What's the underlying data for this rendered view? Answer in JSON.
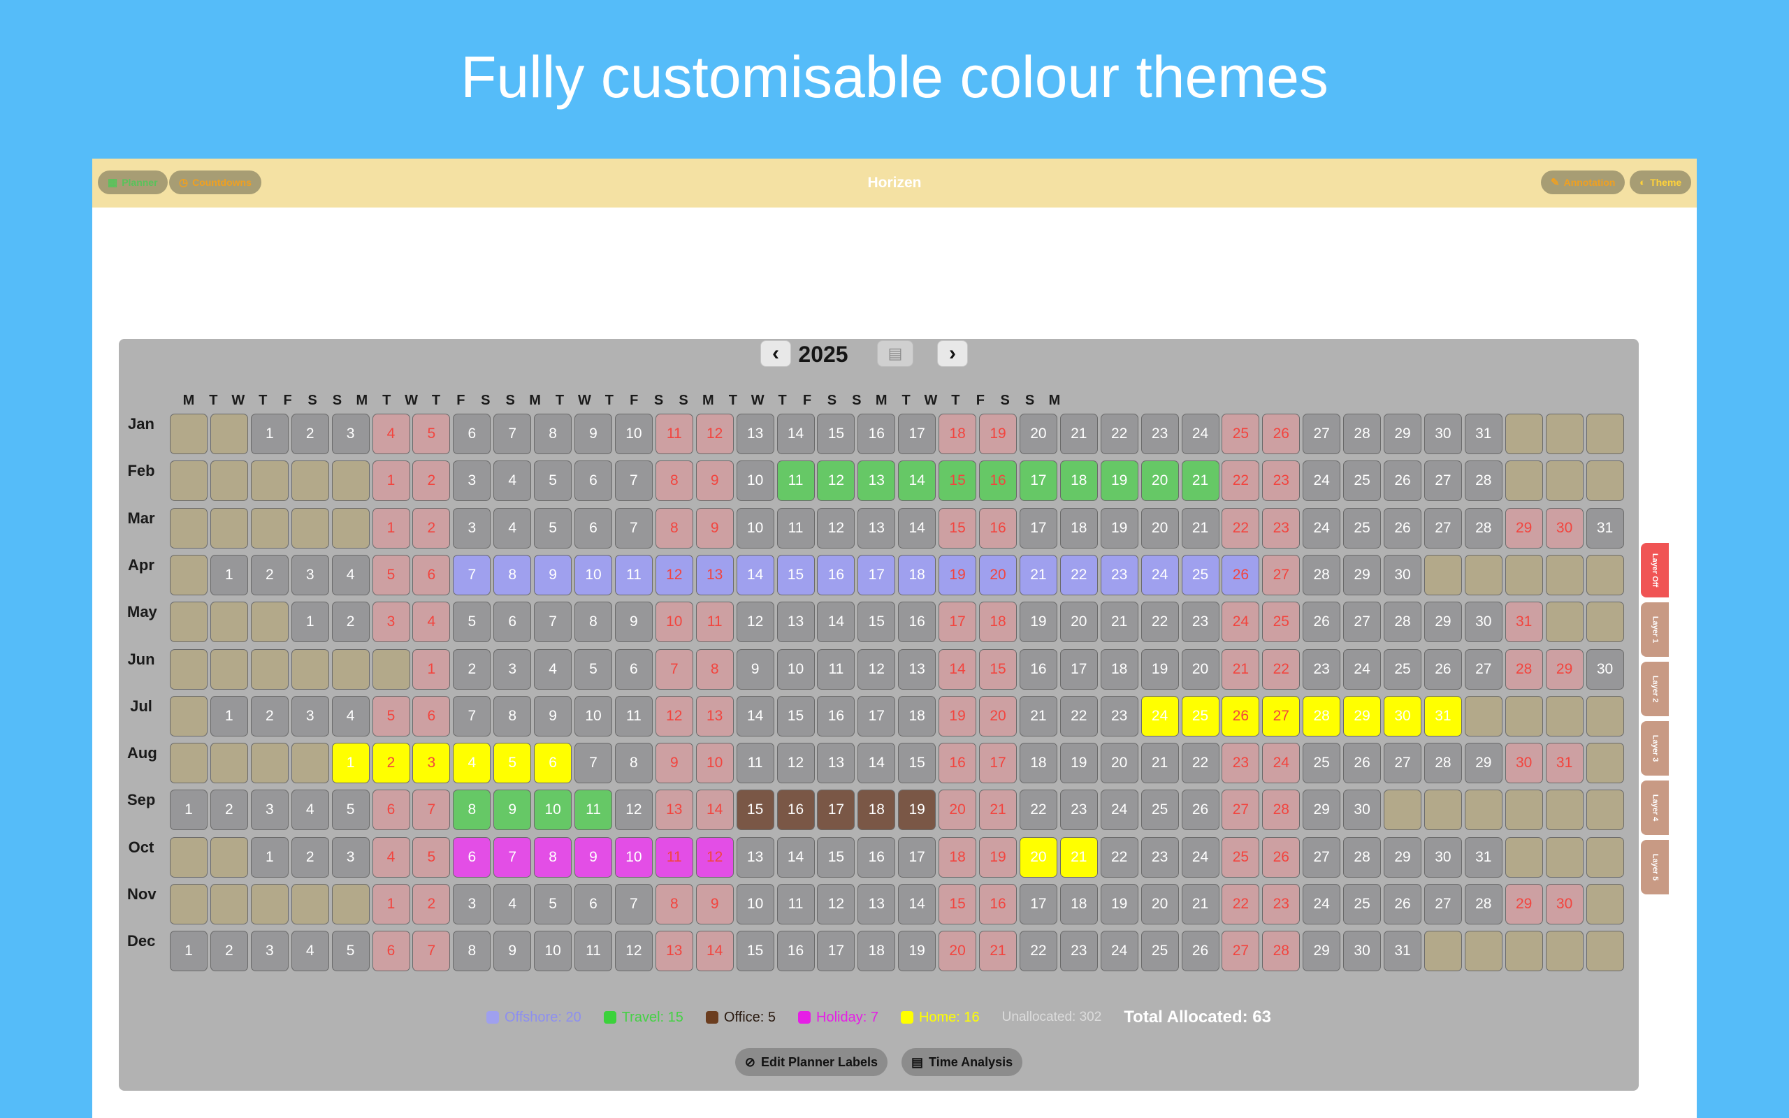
{
  "headline": "Fully customisable colour themes",
  "window": {
    "title": "Horizen",
    "left_buttons": [
      {
        "label": "Planner",
        "icon": "calendar-icon",
        "color": "#58c35b"
      },
      {
        "label": "Countdowns",
        "icon": "clock-icon",
        "color": "#f0a020"
      }
    ],
    "right_buttons": [
      {
        "label": "Annotation",
        "icon": "annotation-icon",
        "color": "#f0a020"
      },
      {
        "label": "Theme",
        "icon": "palette-icon",
        "color": "#ffd23a"
      }
    ]
  },
  "planner": {
    "year": "2025",
    "prev_icon": "chevron-left-icon",
    "next_icon": "chevron-right-icon",
    "doc_icon": "document-icon",
    "day_headers": [
      "M",
      "T",
      "W",
      "T",
      "F",
      "S",
      "S",
      "M",
      "T",
      "W",
      "T",
      "F",
      "S",
      "S",
      "M",
      "T",
      "W",
      "T",
      "F",
      "S",
      "S",
      "M",
      "T",
      "W",
      "T",
      "F",
      "S",
      "S",
      "M",
      "T",
      "W",
      "T",
      "F",
      "S",
      "S",
      "M"
    ],
    "months": [
      {
        "name": "Jan",
        "offset": 2,
        "days": 31,
        "alloc": {}
      },
      {
        "name": "Feb",
        "offset": 5,
        "days": 28,
        "alloc": {
          "11": "trv",
          "12": "trv",
          "13": "trv",
          "14": "trv",
          "15": "trv",
          "16": "trv",
          "17": "trv",
          "18": "trv",
          "19": "trv",
          "20": "trv",
          "21": "trv"
        }
      },
      {
        "name": "Mar",
        "offset": 5,
        "days": 31,
        "alloc": {}
      },
      {
        "name": "Apr",
        "offset": 1,
        "days": 30,
        "alloc": {
          "7": "off",
          "8": "off",
          "9": "off",
          "10": "off",
          "11": "off",
          "12": "off",
          "13": "off",
          "14": "off",
          "15": "off",
          "16": "off",
          "17": "off",
          "18": "off",
          "19": "off",
          "20": "off",
          "21": "off",
          "22": "off",
          "23": "off",
          "24": "off",
          "25": "off",
          "26": "off"
        }
      },
      {
        "name": "May",
        "offset": 3,
        "days": 31,
        "alloc": {}
      },
      {
        "name": "Jun",
        "offset": 6,
        "days": 30,
        "alloc": {}
      },
      {
        "name": "Jul",
        "offset": 1,
        "days": 31,
        "alloc": {
          "24": "home",
          "25": "home",
          "26": "home",
          "27": "home",
          "28": "home",
          "29": "home",
          "30": "home",
          "31": "home"
        }
      },
      {
        "name": "Aug",
        "offset": 4,
        "days": 31,
        "alloc": {
          "1": "home",
          "2": "home",
          "3": "home",
          "4": "home",
          "5": "home",
          "6": "home"
        }
      },
      {
        "name": "Sep",
        "offset": 0,
        "days": 30,
        "alloc": {
          "8": "trv",
          "9": "trv",
          "10": "trv",
          "11": "trv",
          "15": "ofc",
          "16": "ofc",
          "17": "ofc",
          "18": "ofc",
          "19": "ofc"
        }
      },
      {
        "name": "Oct",
        "offset": 2,
        "days": 31,
        "alloc": {
          "6": "hol",
          "7": "hol",
          "8": "hol",
          "9": "hol",
          "10": "hol",
          "11": "hol",
          "12": "hol",
          "20": "home",
          "21": "home"
        }
      },
      {
        "name": "Nov",
        "offset": 5,
        "days": 30,
        "alloc": {}
      },
      {
        "name": "Dec",
        "offset": 0,
        "days": 31,
        "alloc": {}
      }
    ]
  },
  "legend": {
    "items": [
      {
        "label": "Offshore: 20",
        "color": "#9fa0ee",
        "text_color": "#8d8ff0"
      },
      {
        "label": "Travel: 15",
        "color": "#3bd23b",
        "text_color": "#45d145"
      },
      {
        "label": "Office: 5",
        "color": "#6b3d1f",
        "text_color": "#2a1a10"
      },
      {
        "label": "Holiday: 7",
        "color": "#e61ee6",
        "text_color": "#e61ee6"
      },
      {
        "label": "Home: 16",
        "color": "#ffff00",
        "text_color": "#ffff00"
      }
    ],
    "unallocated": "Unallocated: 302",
    "total": "Total Allocated: 63"
  },
  "actions": [
    {
      "label": "Edit Planner Labels",
      "icon": "edit-icon"
    },
    {
      "label": "Time Analysis",
      "icon": "document-icon"
    }
  ],
  "layer_tabs": [
    {
      "label": "Layer Off",
      "color": "#f05454"
    },
    {
      "label": "Layer 1",
      "color": "#c89a84"
    },
    {
      "label": "Layer 2",
      "color": "#c89a84"
    },
    {
      "label": "Layer 3",
      "color": "#c89a84"
    },
    {
      "label": "Layer 4",
      "color": "#c89a84"
    },
    {
      "label": "Layer 5",
      "color": "#c89a84"
    }
  ]
}
